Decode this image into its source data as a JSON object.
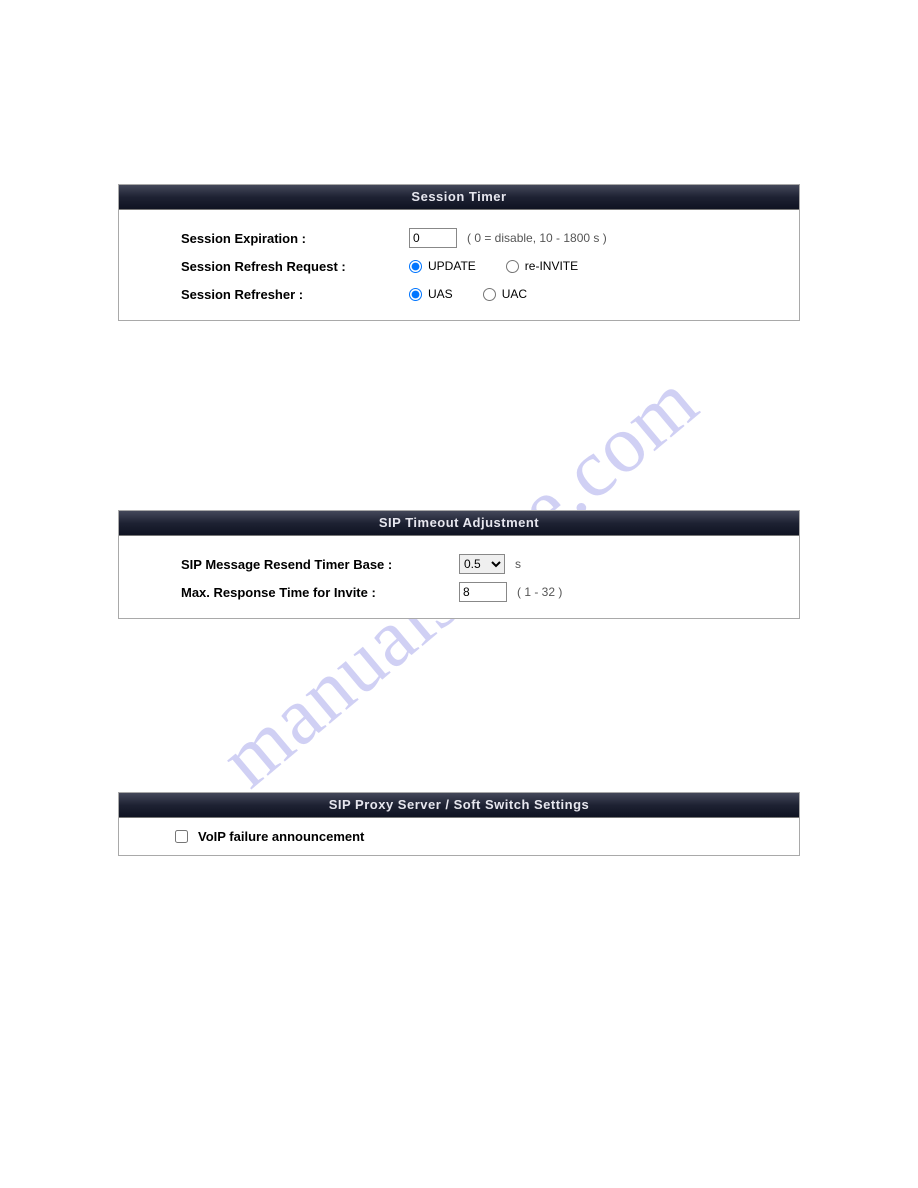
{
  "watermark": "manualshive.com",
  "session_timer": {
    "header": "Session Timer",
    "expiration_label": "Session Expiration :",
    "expiration_value": "0",
    "expiration_hint": "( 0 = disable, 10 - 1800 s )",
    "refresh_request_label": "Session Refresh Request :",
    "opt_update": "UPDATE",
    "opt_reinvite": "re-INVITE",
    "refresher_label": "Session Refresher :",
    "opt_uas": "UAS",
    "opt_uac": "UAC"
  },
  "sip_timeout": {
    "header": "SIP Timeout Adjustment",
    "resend_label": "SIP Message Resend Timer Base :",
    "resend_value": "0.5",
    "resend_unit": "s",
    "max_resp_label": "Max. Response Time for Invite :",
    "max_resp_value": "8",
    "max_resp_hint": "( 1 - 32 )"
  },
  "sip_proxy": {
    "header": "SIP Proxy Server / Soft Switch Settings",
    "voip_failure_label": "VoIP failure announcement"
  }
}
